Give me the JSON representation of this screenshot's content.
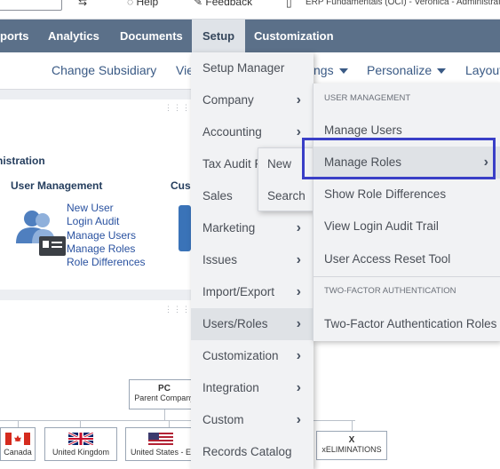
{
  "topbar": {
    "help": "Help",
    "feedback": "Feedback",
    "account": "ERP Fundamentals (OCI) - Veronica - Administrator"
  },
  "nav": {
    "items": [
      "ports",
      "Analytics",
      "Documents",
      "Setup",
      "Customization"
    ],
    "active": "Setup"
  },
  "subnav": {
    "change_subsidiary": "Change Subsidiary",
    "view_partial": "Vie",
    "settings_partial": "ngs",
    "personalize": "Personalize",
    "layout": "Layout"
  },
  "portlet": {
    "admin_title": "nistration",
    "user_management_title": "User Management",
    "custom_title_partial": "Cus",
    "user_links": [
      "New User",
      "Login Audit",
      "Manage Users",
      "Manage Roles",
      "Role Differences"
    ]
  },
  "setup_menu": {
    "items": [
      {
        "label": "Setup Manager",
        "arrow": false
      },
      {
        "label": "Company",
        "arrow": true
      },
      {
        "label": "Accounting",
        "arrow": true
      },
      {
        "label": "Tax Audit F",
        "arrow": false
      },
      {
        "label": "Sales",
        "arrow": false
      },
      {
        "label": "Marketing",
        "arrow": true
      },
      {
        "label": "Issues",
        "arrow": true
      },
      {
        "label": "Import/Export",
        "arrow": true
      },
      {
        "label": "Users/Roles",
        "arrow": true
      },
      {
        "label": "Customization",
        "arrow": true
      },
      {
        "label": "Integration",
        "arrow": true
      },
      {
        "label": "Custom",
        "arrow": true
      },
      {
        "label": "Records Catalog",
        "arrow": false
      }
    ],
    "hovered": "Users/Roles"
  },
  "accounting_flyout": {
    "items": [
      "New",
      "Search"
    ]
  },
  "users_roles_menu": {
    "section1": "USER MANAGEMENT",
    "items1": [
      "Manage Users",
      "Manage Roles",
      "Show Role Differences",
      "View Login Audit Trail",
      "User Access Reset Tool"
    ],
    "section2": "TWO-FACTOR AUTHENTICATION",
    "items2": [
      "Two-Factor Authentication Roles"
    ],
    "hovered": "Manage Roles"
  },
  "org_chart": {
    "parent_code": "PC",
    "parent_name": "Parent Company",
    "children": [
      "Canada",
      "United Kingdom",
      "United States - E"
    ],
    "elim_code": "X",
    "elim_name": "xELIMINATIONS"
  },
  "colors": {
    "nav_bg": "#5b7089",
    "highlight": "#3a3fc7",
    "link": "#2a52a0"
  }
}
